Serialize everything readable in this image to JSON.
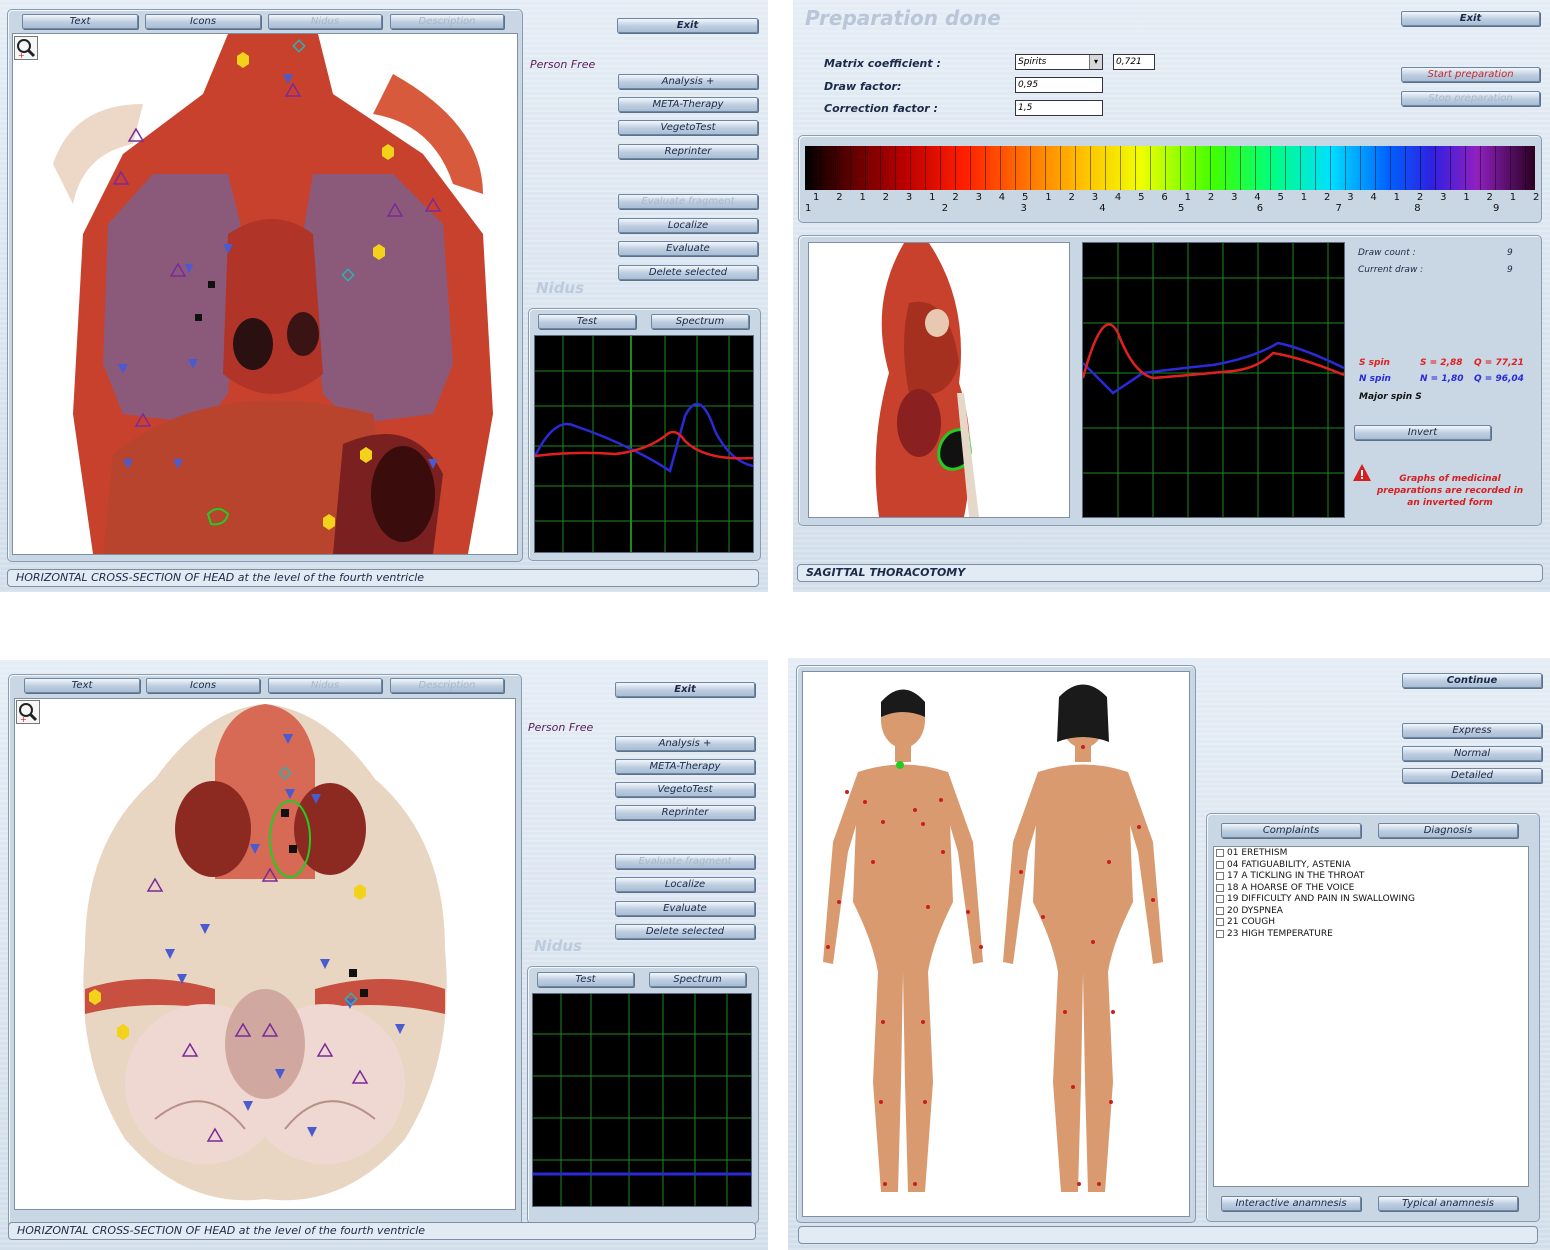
{
  "panel1": {
    "tabs": [
      "Text",
      "Icons",
      "Nidus",
      "Description"
    ],
    "person": "Person Free",
    "nidus_label": "Nidus",
    "buttons": {
      "exit": "Exit",
      "analysis": "Analysis +",
      "meta": "META-Therapy",
      "vegeto": "VegetoTest",
      "reprinter": "Reprinter",
      "evaluate_fragment": "Evaluate fragment",
      "localize": "Localize",
      "evaluate": "Evaluate",
      "delete": "Delete selected"
    },
    "scope_tabs": [
      "Test",
      "Spectrum"
    ],
    "status": "HORIZONTAL CROSS-SECTION OF HEAD at the level of the fourth ventricle"
  },
  "panel2": {
    "title": "Preparation done",
    "exit": "Exit",
    "start": "Start preparation",
    "stop": "Stop preparation",
    "matrix_label": "Matrix coefficient :",
    "matrix_select": "Spirits",
    "matrix_value": "0,721",
    "draw_label": "Draw factor:",
    "draw_value": "0,95",
    "corr_label": "Correction factor :",
    "corr_value": "1,5",
    "spectrum_top": [
      "1",
      "2",
      "1",
      "2",
      "3",
      "1",
      "2",
      "3",
      "4",
      "5",
      "1",
      "2",
      "3",
      "4",
      "5",
      "6",
      "1",
      "2",
      "3",
      "4",
      "5",
      "1",
      "2",
      "3",
      "4",
      "1",
      "2",
      "3",
      "1",
      "2",
      "1",
      "2"
    ],
    "spectrum_bottom": [
      "1",
      "2",
      "3",
      "4",
      "5",
      "6",
      "7",
      "8",
      "9"
    ],
    "draw_count_label": "Draw count :",
    "draw_count": "9",
    "current_draw_label": "Current draw :",
    "current_draw": "9",
    "s_spin": "S spin",
    "s_vals": [
      "S = 2,88",
      "Q = 77,21"
    ],
    "n_spin": "N spin",
    "n_vals": [
      "N = 1,80",
      "Q = 96,04"
    ],
    "major": "Major spin S",
    "invert": "Invert",
    "warning": [
      "Graphs of medicinal",
      "preparations are recorded in",
      "an inverted form"
    ],
    "status": "SAGITTAL THORACOTOMY"
  },
  "panel3": {
    "tabs": [
      "Text",
      "Icons",
      "Nidus",
      "Description"
    ],
    "person": "Person Free",
    "nidus_label": "Nidus",
    "buttons": {
      "exit": "Exit",
      "analysis": "Analysis +",
      "meta": "META-Therapy",
      "vegeto": "VegetoTest",
      "reprinter": "Reprinter",
      "evaluate_fragment": "Evaluate fragment",
      "localize": "Localize",
      "evaluate": "Evaluate",
      "delete": "Delete selected"
    },
    "scope_tabs": [
      "Test",
      "Spectrum"
    ],
    "status": "HORIZONTAL CROSS-SECTION OF HEAD at the level of the fourth ventricle"
  },
  "panel4": {
    "continue": "Continue",
    "express": "Express",
    "normal": "Normal",
    "detailed": "Detailed",
    "complaints_tab": "Complaints",
    "diagnosis_tab": "Diagnosis",
    "complaints": [
      "01 ERETHISM",
      "04 FATIGUABILITY, ASTENIA",
      "17 A TICKLING IN THE THROAT",
      "18 A HOARSE OF THE VOICE",
      "19 DIFFICULTY AND PAIN IN SWALLOWING",
      "20 DYSPNEA",
      "21 COUGH",
      "23 HIGH TEMPERATURE"
    ],
    "interactive": "Interactive anamnesis",
    "typical": "Typical anamnesis"
  },
  "colors": {
    "panel": "#d9e3ee",
    "blue_curve": "#2a2ad8",
    "red_curve": "#e02020",
    "grid": "#1d8a1d",
    "accent_text": "#5a1e5a"
  }
}
